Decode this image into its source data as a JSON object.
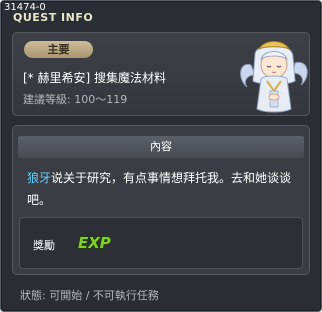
{
  "window": {
    "quest_id": "31474-0",
    "title": "QUEST INFO"
  },
  "header": {
    "tag_label": "主要",
    "quest_name": "[* 赫里希安] 搜集魔法材料",
    "level_req": "建議等級: 100～119",
    "npc_icon": "npc-portrait-icon"
  },
  "content": {
    "heading": "內容",
    "npc_name": "狼牙",
    "description": "说关于研究，有点事情想拜托我。去和她谈谈吧。",
    "reward_label": "獎勵",
    "reward_icon": "exp-icon",
    "reward_text": "EXP"
  },
  "status": {
    "text": "狀態: 可開始 / 不可執行任務"
  },
  "colors": {
    "background": "#2a2d33",
    "npc_link": "#5fd1ff",
    "tag": "#b9a67f",
    "exp_green": "#7fd12a"
  }
}
